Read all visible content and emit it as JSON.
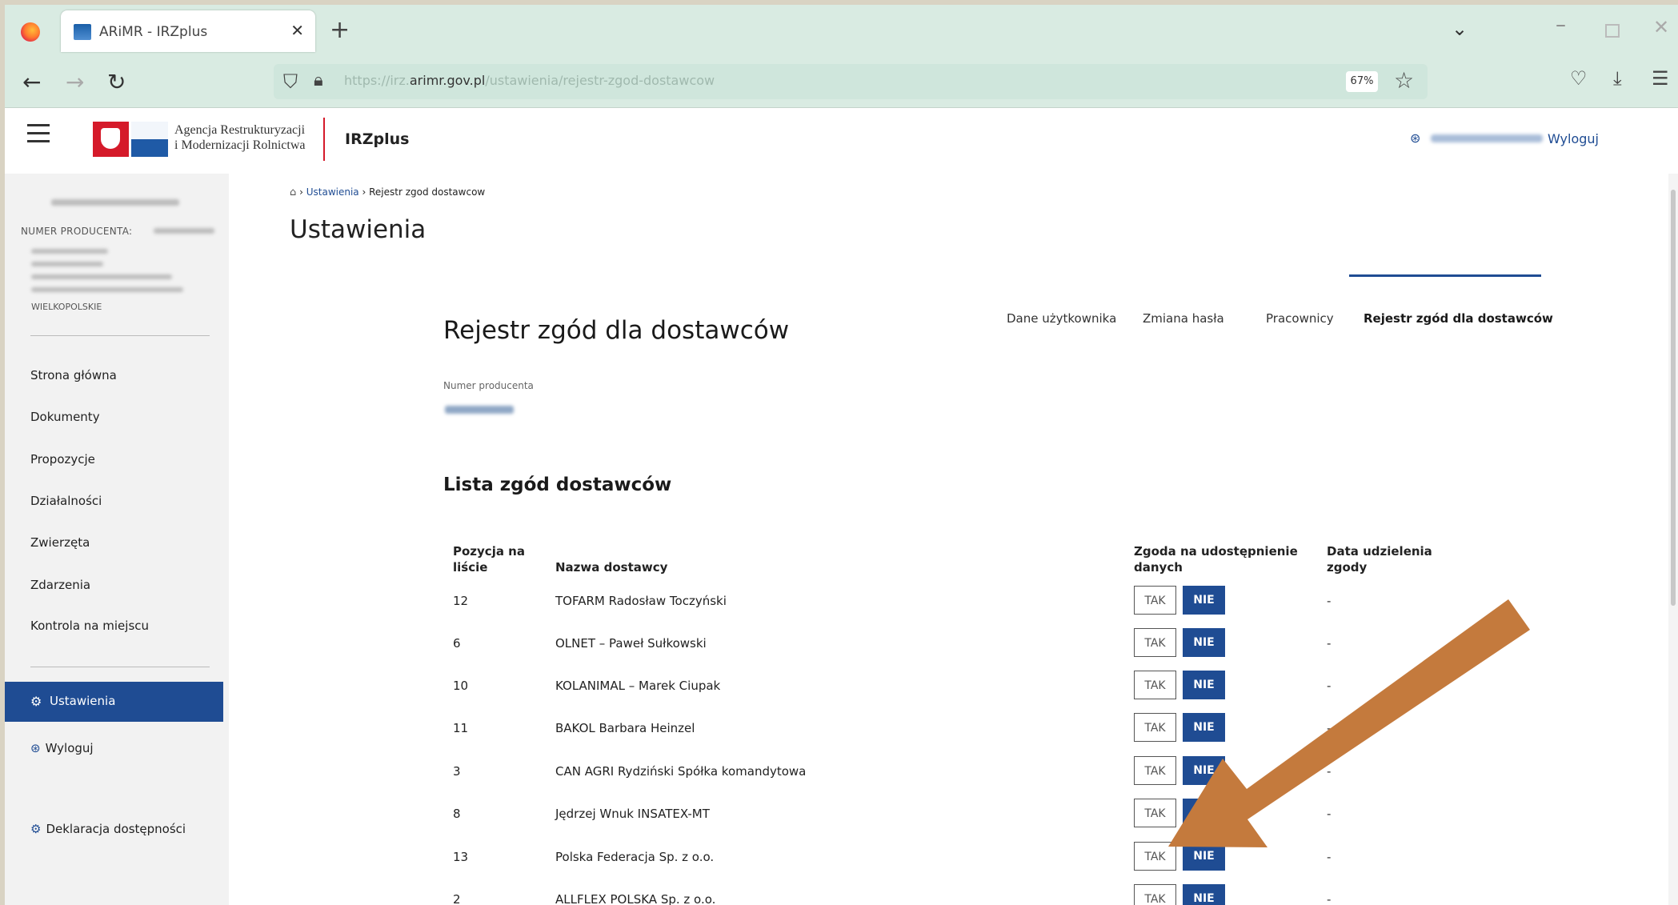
{
  "browser": {
    "tab_title": "ARiMR - IRZplus",
    "url_prefix": "https://irz.",
    "url_domain": "arimr.gov.pl",
    "url_path": "/ustawienia/rejestr-zgod-dostawcow",
    "zoom": "67%"
  },
  "header": {
    "org_line1": "Agencja Restrukturyzacji",
    "org_line2": "i Modernizacji Rolnictwa",
    "app_name": "IRZplus",
    "logout": "Wyloguj"
  },
  "sidebar": {
    "producer_label": "NUMER PRODUCENTA:",
    "voivodeship": "WIELKOPOLSKIE",
    "items": [
      {
        "label": "Strona główna"
      },
      {
        "label": "Dokumenty"
      },
      {
        "label": "Propozycje"
      },
      {
        "label": "Działalności"
      },
      {
        "label": "Zwierzęta"
      },
      {
        "label": "Zdarzenia"
      },
      {
        "label": "Kontrola na miejscu"
      }
    ],
    "active": "Ustawienia",
    "logout": "Wyloguj",
    "accessibility": "Deklaracja dostępności"
  },
  "breadcrumb": {
    "level1": "Ustawienia",
    "level2": "Rejestr zgod dostawcow"
  },
  "page": {
    "title": "Ustawienia",
    "tabs": [
      "Dane użytkownika",
      "Zmiana hasła",
      "Pracownicy",
      "Rejestr zgód dla dostawców"
    ],
    "section_title": "Rejestr zgód dla dostawców",
    "producer_number_label": "Numer producenta",
    "list_title": "Lista zgód dostawców"
  },
  "table": {
    "headers": {
      "position_1": "Pozycja na",
      "position_2": "liście",
      "name": "Nazwa dostawcy",
      "consent_1": "Zgoda na udostępnienie",
      "consent_2": "danych",
      "date_1": "Data udzielenia",
      "date_2": "zgody"
    },
    "yes_label": "TAK",
    "no_label": "NIE",
    "rows": [
      {
        "position": "12",
        "name": "TOFARM Radosław Toczyński",
        "date": "-"
      },
      {
        "position": "6",
        "name": "OLNET – Paweł Sułkowski",
        "date": "-"
      },
      {
        "position": "10",
        "name": "KOLANIMAL – Marek Ciupak",
        "date": "-"
      },
      {
        "position": "11",
        "name": "BAKOL Barbara Heinzel",
        "date": "-"
      },
      {
        "position": "3",
        "name": "CAN AGRI Rydziński Spółka komandytowa",
        "date": "-"
      },
      {
        "position": "8",
        "name": "Jędrzej Wnuk INSATEX-MT",
        "date": "-"
      },
      {
        "position": "13",
        "name": "Polska Federacja Sp. z o.o.",
        "date": "-"
      },
      {
        "position": "2",
        "name": "ALLFLEX POLSKA Sp. z o.o.",
        "date": "-"
      }
    ]
  },
  "colors": {
    "primary": "#1f4c93",
    "annotation_arrow": "#c47a3d",
    "browser_chrome": "#d9ebe2"
  }
}
